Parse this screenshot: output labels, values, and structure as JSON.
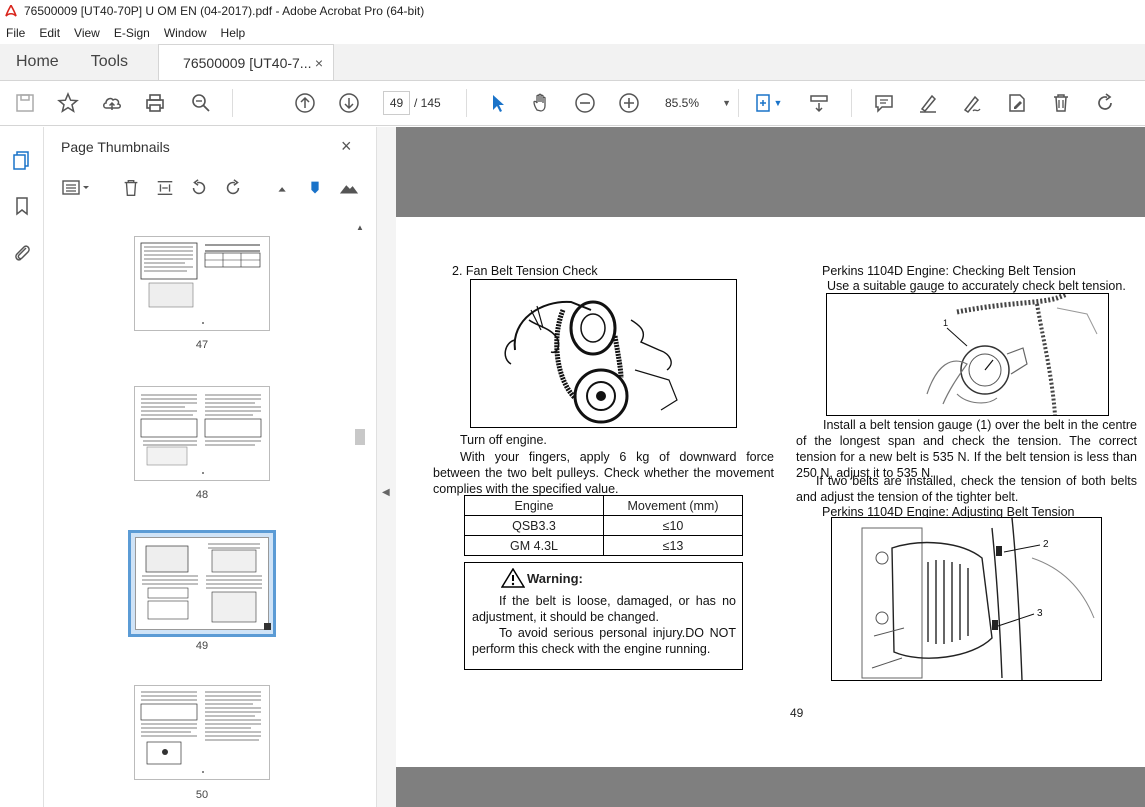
{
  "window": {
    "title": "76500009 [UT40-70P] U OM EN (04-2017).pdf - Adobe Acrobat Pro (64-bit)"
  },
  "menu": [
    "File",
    "Edit",
    "View",
    "E-Sign",
    "Window",
    "Help"
  ],
  "tabs": {
    "home": "Home",
    "tools": "Tools",
    "document": "76500009 [UT40-7...",
    "close": "×"
  },
  "toolbar": {
    "current_page": "49",
    "total_pages": "/ 145",
    "zoom": "85.5%"
  },
  "panel": {
    "title": "Page Thumbnails",
    "close": "×",
    "thumbnails": [
      {
        "label": "47"
      },
      {
        "label": "48"
      },
      {
        "label": "49",
        "selected": true
      },
      {
        "label": "50"
      }
    ]
  },
  "page": {
    "left": {
      "heading": "2. Fan Belt Tension Check",
      "step1": "Turn off engine.",
      "step2": "With your fingers, apply 6 kg of downward force between the two belt pulleys. Check whether the movement complies with the specified value.",
      "table": {
        "headers": [
          "Engine",
          "Movement (mm)"
        ],
        "rows": [
          [
            "QSB3.3",
            "≤10"
          ],
          [
            "GM 4.3L",
            "≤13"
          ]
        ]
      },
      "warning": {
        "title": "Warning:",
        "line1": "If the belt is loose, damaged, or has no adjustment, it should be changed.",
        "line2": "To avoid serious personal injury.DO NOT perform this check with the engine running."
      }
    },
    "right": {
      "heading1": "Perkins 1104D Engine: Checking Belt Tension",
      "sub1": "Use a suitable gauge to accurately check belt tension.",
      "fig1_label": "1",
      "para1": "Install a belt tension gauge (1) over the belt in the centre of the longest span and check the tension. The correct tension for a new belt is 535 N. If the belt tension is less than 250 N, adjust it to 535 N.",
      "para2": "If two belts are installed, check the tension of both belts and adjust the tension of the tighter belt.",
      "heading2": "Perkins 1104D Engine: Adjusting Belt Tension",
      "fig2_label2": "2",
      "fig2_label3": "3"
    },
    "number": "49"
  }
}
